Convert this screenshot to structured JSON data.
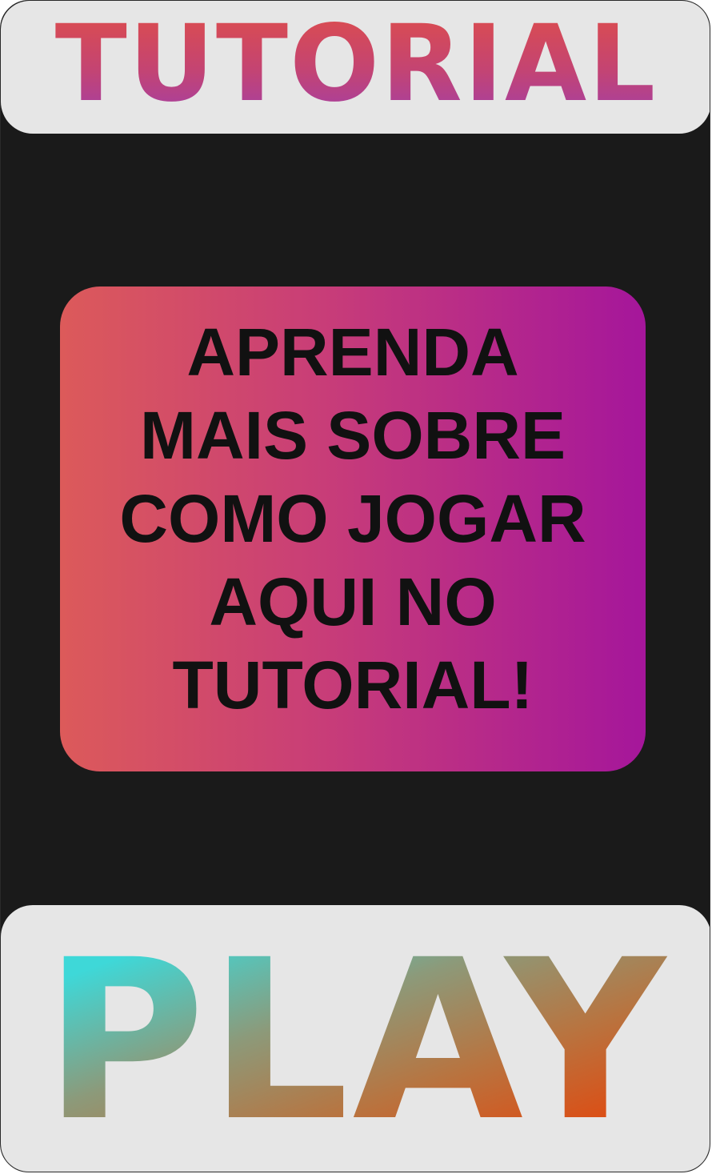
{
  "header": {
    "title": "TUTORIAL"
  },
  "info_card": {
    "message": "APRENDA\nMAIS SOBRE\nCOMO JOGAR\nAQUI NO\nTUTORIAL!"
  },
  "play_button": {
    "label": "PLAY"
  },
  "colors": {
    "background": "#1a1a1a",
    "panel": "#e6e6e6",
    "card_gradient_start": "#dc5a5a",
    "card_gradient_end": "#a5169b",
    "play_gradient_start": "#3ed8d8",
    "play_gradient_end": "#e04a10"
  }
}
